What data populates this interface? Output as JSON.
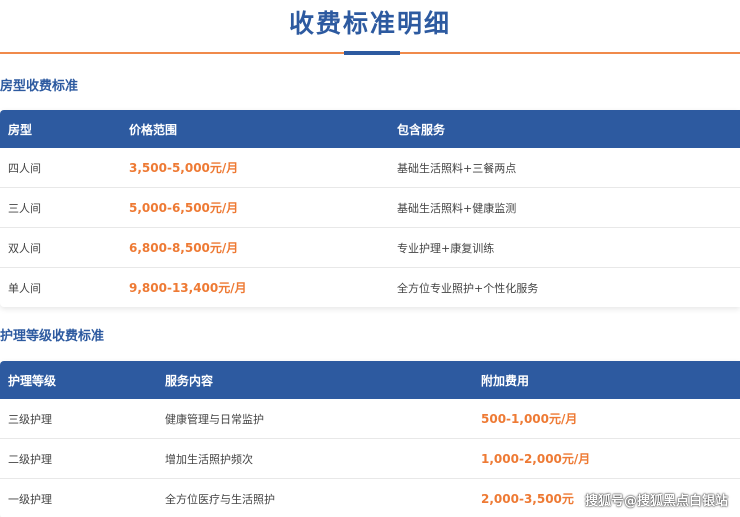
{
  "page_title": "收费标准明细",
  "room_section": {
    "title": "房型收费标准",
    "headers": [
      "房型",
      "价格范围",
      "包含服务"
    ],
    "rows": [
      {
        "type": "四人间",
        "price": "3,500-5,000元/月",
        "service": "基础生活照料+三餐两点"
      },
      {
        "type": "三人间",
        "price": "5,000-6,500元/月",
        "service": "基础生活照料+健康监测"
      },
      {
        "type": "双人间",
        "price": "6,800-8,500元/月",
        "service": "专业护理+康复训练"
      },
      {
        "type": "单人间",
        "price": "9,800-13,400元/月",
        "service": "全方位专业照护+个性化服务"
      }
    ]
  },
  "care_section": {
    "title": "护理等级收费标准",
    "headers": [
      "护理等级",
      "服务内容",
      "附加费用"
    ],
    "rows": [
      {
        "level": "三级护理",
        "content": "健康管理与日常监护",
        "fee": "500-1,000元/月"
      },
      {
        "level": "二级护理",
        "content": "增加生活照护频次",
        "fee": "1,000-2,000元/月"
      },
      {
        "level": "一级护理",
        "content": "全方位医疗与生活照护",
        "fee": "2,000-3,500元"
      }
    ]
  },
  "watermark": "搜狐号@搜狐黑点白银站",
  "colors": {
    "primary": "#2d5aa0",
    "accent": "#ee7a34",
    "rule": "#f08a4b"
  }
}
